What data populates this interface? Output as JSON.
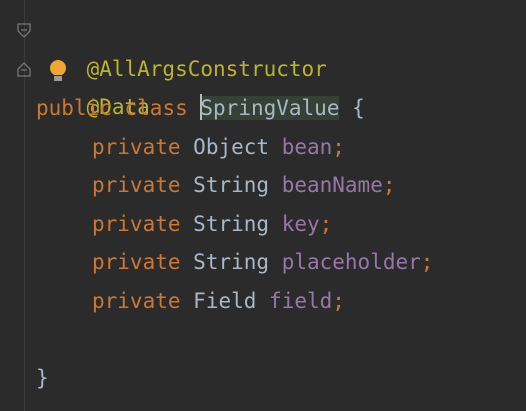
{
  "editor": {
    "lines": [
      {
        "annotation": "@AllArgsConstructor"
      },
      {
        "annotation_at": "@",
        "annotation_rest": "Data"
      },
      {
        "kw1": "public",
        "kw2": "class",
        "class_name": "SpringValue",
        "open_brace": "{"
      },
      {
        "kw": "private",
        "type": "Object",
        "name": "bean",
        "semi": ";"
      },
      {
        "kw": "private",
        "type": "String",
        "name": "beanName",
        "semi": ";"
      },
      {
        "kw": "private",
        "type": "String",
        "name": "key",
        "semi": ";"
      },
      {
        "kw": "private",
        "type": "String",
        "name": "placeholder",
        "semi": ";"
      },
      {
        "kw": "private",
        "type": "Field",
        "name": "field",
        "semi": ";"
      },
      {},
      {
        "close_brace": "}"
      }
    ],
    "icons": {
      "fold_marker": "fold-marker-icon",
      "intention_bulb": "lightbulb-icon"
    },
    "colors": {
      "background": "#2b2b2b",
      "keyword": "#cc7832",
      "annotation": "#bbb529",
      "field": "#9876aa",
      "text": "#a9b7c6",
      "highlight": "#344134",
      "bulb": "#f0a732"
    }
  }
}
